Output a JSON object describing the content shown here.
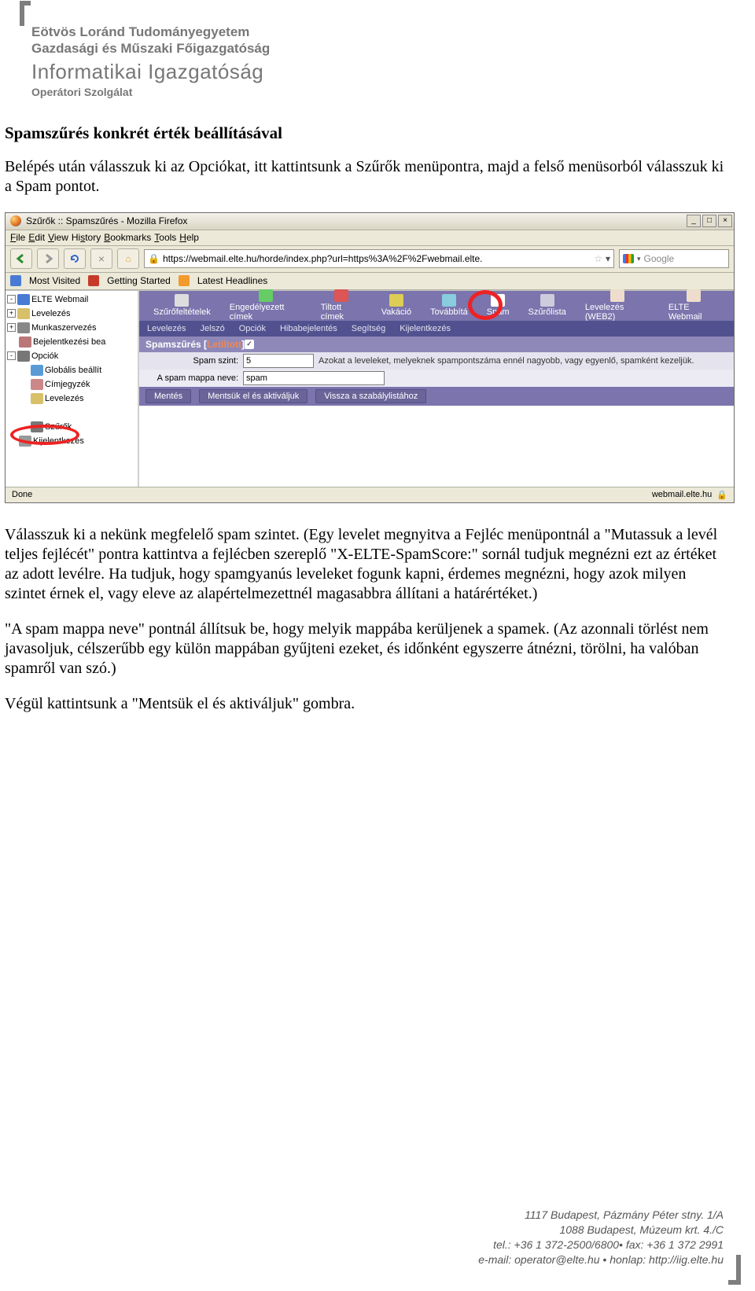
{
  "letterhead": {
    "l1": "Eötvös Loránd Tudományegyetem",
    "l2": "Gazdasági és Műszaki Főigazgatóság",
    "l3": "Informatikai Igazgatóság",
    "l4": "Operátori Szolgálat"
  },
  "doc": {
    "title": "Spamszűrés konkrét érték beállításával",
    "p1": "Belépés után válasszuk ki az Opciókat, itt kattintsunk a Szűrők menüpontra, majd a felső menüsorból válasszuk ki a Spam pontot.",
    "p2": "Válasszuk ki a nekünk megfelelő spam szintet. (Egy levelet megnyitva a Fejléc menüpontnál a \"Mutassuk a levél teljes fejlécét\" pontra kattintva a fejlécben szereplő \"X-ELTE-SpamScore:\" sornál tudjuk megnézni ezt az értéket az adott levélre. Ha tudjuk, hogy spamgyanús leveleket fogunk kapni, érdemes megnézni, hogy azok milyen szintet érnek el, vagy eleve az alapértelmezettnél magasabbra állítani a határértéket.)",
    "p3": "\"A spam mappa neve\" pontnál állítsuk be, hogy melyik mappába kerüljenek a spamek. (Az azonnali törlést nem javasoljuk, célszerűbb egy külön mappában gyűjteni ezeket, és időnként egyszerre átnézni, törölni, ha valóban spamről van szó.)",
    "p4": "Végül kattintsunk a \"Mentsük el és aktiváljuk\" gombra."
  },
  "browser": {
    "title": "Szűrők :: Spamszűrés - Mozilla Firefox",
    "menus": [
      "File",
      "Edit",
      "View",
      "History",
      "Bookmarks",
      "Tools",
      "Help"
    ],
    "url": "https://webmail.elte.hu/horde/index.php?url=https%3A%2F%2Fwebmail.elte.",
    "search": {
      "placeholder": "Google",
      "logo": "G"
    },
    "bookmarks": [
      "Most Visited",
      "Getting Started",
      "Latest Headlines"
    ],
    "status_left": "Done",
    "status_right": "webmail.elte.hu"
  },
  "horde": {
    "topnav": [
      "Szűrőfeltételek",
      "Engedélyezett címek",
      "Tiltott címek",
      "Vakáció",
      "Továbbítá",
      "Spam",
      "Szűrőlista",
      "Levelezés (WEB2)",
      "ELTE Webmail"
    ],
    "subnav": [
      "Levelezés",
      "Jelszó",
      "Opciók",
      "Hibabejelentés",
      "Segítség",
      "Kijelentkezés"
    ],
    "section_title_a": "Spamszűrés [",
    "section_title_b": "Letiltott",
    "section_title_c": "] ",
    "form": {
      "level_label": "Spam szint:",
      "level_value": "5",
      "level_hint": "Azokat a leveleket, melyeknek spampontszáma ennél nagyobb, vagy egyenlő, spamként kezeljük.",
      "folder_label": "A spam mappa neve:",
      "folder_value": "spam"
    },
    "buttons": [
      "Mentés",
      "Mentsük el és aktiváljuk",
      "Vissza a szabálylistához"
    ],
    "tree": [
      {
        "exp": "-",
        "icon": "elte",
        "label": "ELTE Webmail",
        "indent": 0
      },
      {
        "exp": "+",
        "icon": "mail",
        "label": "Levelezés",
        "indent": 0
      },
      {
        "exp": "+",
        "icon": "work",
        "label": "Munkaszervezés",
        "indent": 0
      },
      {
        "exp": "",
        "icon": "user",
        "label": "Bejelentkezési bea",
        "indent": 0
      },
      {
        "exp": "-",
        "icon": "tool",
        "label": "Opciók",
        "indent": 0
      },
      {
        "exp": "",
        "icon": "globe",
        "label": "Globális beállít",
        "indent": 1
      },
      {
        "exp": "",
        "icon": "book",
        "label": "Címjegyzék",
        "indent": 1
      },
      {
        "exp": "",
        "icon": "mail",
        "label": "Levelezés",
        "indent": 1
      },
      {
        "exp": "",
        "icon": "blank",
        "label": "",
        "indent": 1
      },
      {
        "exp": "",
        "icon": "funnel",
        "label": "Szűrők",
        "indent": 1,
        "circled": true
      },
      {
        "exp": "",
        "icon": "exit",
        "label": "Kijelentkezés",
        "indent": 0
      }
    ]
  },
  "footer": {
    "l1": "1117 Budapest, Pázmány Péter stny. 1/A",
    "l2": "1088 Budapest, Múzeum krt. 4./C",
    "l3": "tel.: +36 1 372-2500/6800• fax: +36 1 372 2991",
    "l4": "e-mail: operator@elte.hu • honlap: http://iig.elte.hu"
  }
}
